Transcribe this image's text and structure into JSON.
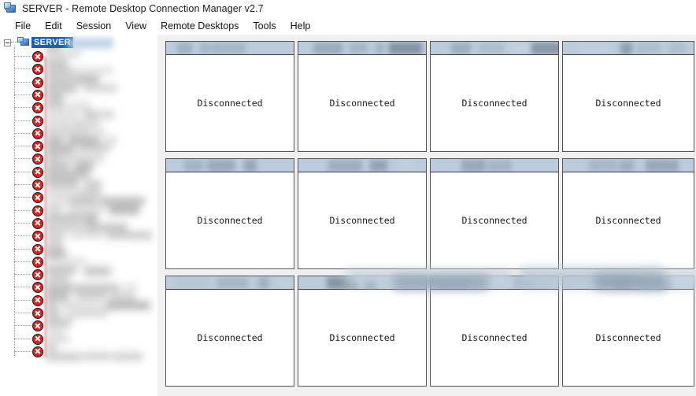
{
  "window": {
    "title": "SERVER - Remote Desktop Connection Manager v2.7",
    "icon": "remote-desktop-icon"
  },
  "menu": {
    "items": [
      {
        "label": "File"
      },
      {
        "label": "Edit"
      },
      {
        "label": "Session"
      },
      {
        "label": "View"
      },
      {
        "label": "Remote Desktops"
      },
      {
        "label": "Tools"
      },
      {
        "label": "Help"
      }
    ]
  },
  "sidebar": {
    "root": {
      "label": "SERVER",
      "selected": true,
      "expanded": true,
      "icon": "server-group-icon",
      "expander_icon": "collapse-box-icon"
    },
    "child_count": 24,
    "child_status_icon": "disconnected-x-icon",
    "child_labels_redacted": true
  },
  "main": {
    "columns": 4,
    "rows": 3,
    "panels": [
      {
        "status": "Disconnected",
        "title_redacted": true
      },
      {
        "status": "Disconnected",
        "title_redacted": true
      },
      {
        "status": "Disconnected",
        "title_redacted": true
      },
      {
        "status": "Disconnected",
        "title_redacted": true
      },
      {
        "status": "Disconnected",
        "title_redacted": true
      },
      {
        "status": "Disconnected",
        "title_redacted": true
      },
      {
        "status": "Disconnected",
        "title_redacted": true
      },
      {
        "status": "Disconnected",
        "title_redacted": true
      },
      {
        "status": "Disconnected",
        "title_redacted": true
      },
      {
        "status": "Disconnected",
        "title_redacted": true
      },
      {
        "status": "Disconnected",
        "title_redacted": true
      },
      {
        "status": "Disconnected",
        "title_redacted": true
      }
    ]
  },
  "colors": {
    "panel_header": "#bcccdd",
    "panel_border": "#555555",
    "selection": "#1064c0",
    "status_error": "#e21f1f",
    "workspace_bg": "#f0f0f0",
    "window_bg": "#ffffff"
  }
}
